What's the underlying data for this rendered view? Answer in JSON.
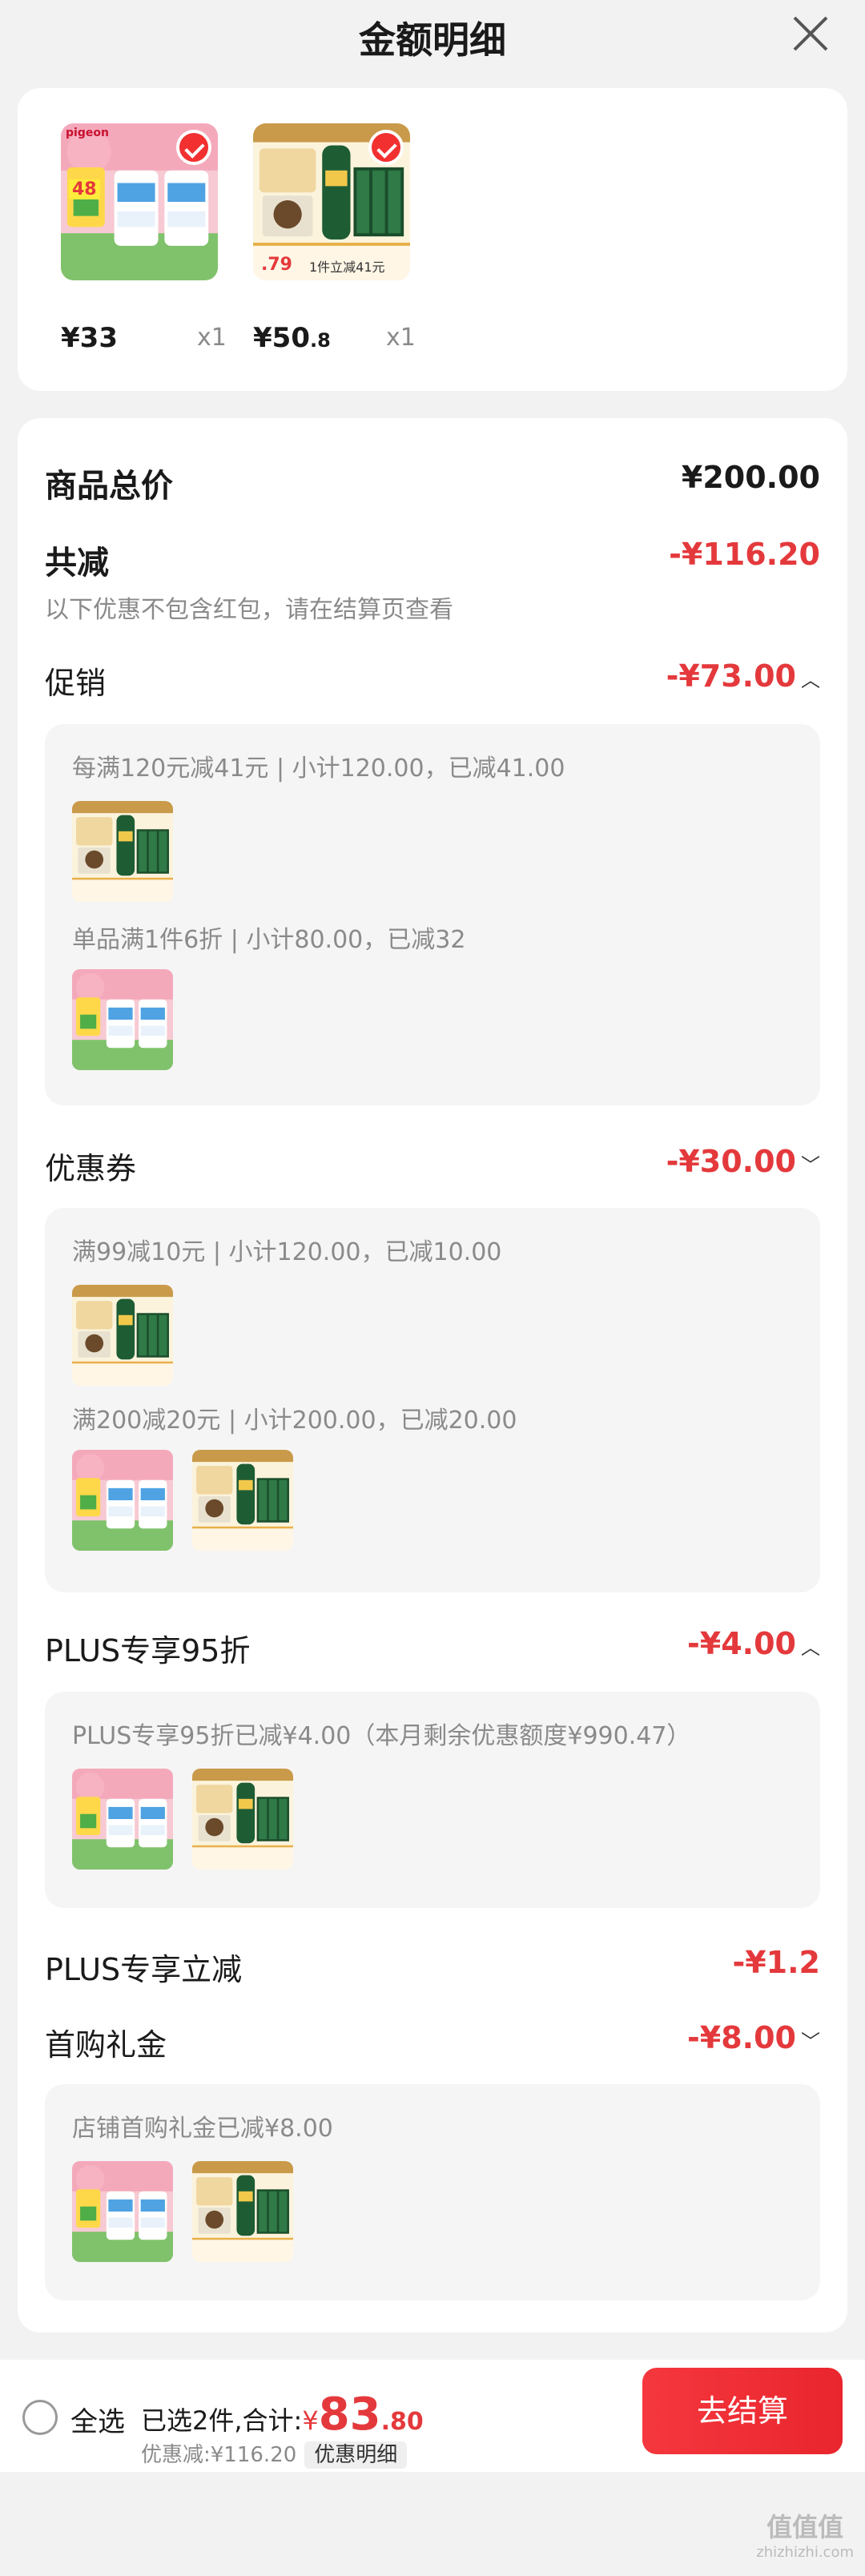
{
  "header": {
    "title": "金额明细"
  },
  "items": [
    {
      "price_int": "¥33",
      "price_dec": "",
      "qty": "x1"
    },
    {
      "price_int": "¥50",
      "price_dec": ".8",
      "qty": "x1"
    }
  ],
  "thumb_text": {
    "brand": "pigeon",
    "badge": "48",
    "offer_price": ".79",
    "offer_text": "1件立减41元"
  },
  "summary": {
    "total_label": "商品总价",
    "total_value": "¥200.00",
    "reduce_label": "共减",
    "reduce_value": "-¥116.20",
    "reduce_note": "以下优惠不包含红包，请在结算页查看"
  },
  "sections": {
    "promo": {
      "label": "促销",
      "value": "-¥73.00",
      "lines": [
        "每满120元减41元 | 小计120.00，已减41.00",
        "单品满1件6折 | 小计80.00，已减32"
      ]
    },
    "coupon": {
      "label": "优惠券",
      "value": "-¥30.00",
      "lines": [
        "满99减10元 | 小计120.00，已减10.00",
        "满200减20元 | 小计200.00，已减20.00"
      ]
    },
    "plus95": {
      "label": "PLUS专享95折",
      "value": "-¥4.00",
      "lines": [
        "PLUS专享95折已减¥4.00（本月剩余优惠额度¥990.47）"
      ]
    },
    "plusreduce": {
      "label": "PLUS专享立减",
      "value": "-¥1.2"
    },
    "gift": {
      "label": "首购礼金",
      "value": "-¥8.00",
      "lines": [
        "店铺首购礼金已减¥8.00"
      ]
    }
  },
  "footer": {
    "select_all": "全选",
    "selected_text": "已选2件,合计:",
    "currency": "¥",
    "amount_int": "83",
    "amount_dec": ".80",
    "discount_text": "优惠减:¥116.20",
    "detail_button": "优惠明细",
    "checkout": "去结算"
  },
  "watermark": {
    "main": "值值值",
    "sub": "zhizhizhi.com"
  },
  "colors": {
    "accent": "#e4393c",
    "checkout": "#f23030"
  }
}
